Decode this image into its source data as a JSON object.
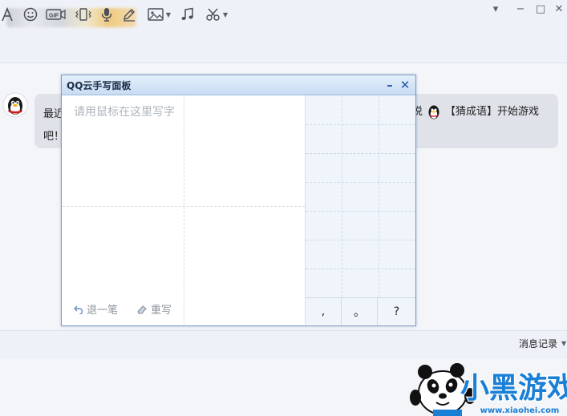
{
  "window": {
    "controls": {
      "dropdown": "▾",
      "minimize": "−",
      "maximize": "□",
      "close": "✕"
    }
  },
  "chat": {
    "message_left_line1": "最近",
    "message_left_line2": "吧！",
    "message_right_text": "【猜成语】开始游戏",
    "message_right_prefix": "说"
  },
  "handwriting_panel": {
    "title": "QQ云手写面板",
    "minimize": "–",
    "close": "✕",
    "placeholder": "请用鼠标在这里写字",
    "undo_label": "退一笔",
    "rewrite_label": "重写",
    "punctuation": [
      ",",
      "。",
      "?"
    ]
  },
  "toolbar": {
    "icons": [
      "font-icon",
      "emoji-icon",
      "gif-icon",
      "vibrate-icon",
      "voice-icon",
      "pen-icon",
      "image-icon",
      "music-icon",
      "scissors-icon"
    ],
    "history_label": "消息记录"
  },
  "watermark": {
    "brand_text": "小黑游戏",
    "url": "www.xiaohei.com"
  },
  "colors": {
    "accent_blue": "#1f5aa8",
    "panel_border": "#7b9cc7",
    "bubble_bg": "#dfe2e8",
    "watermark_blue": "#1a7fd6"
  }
}
